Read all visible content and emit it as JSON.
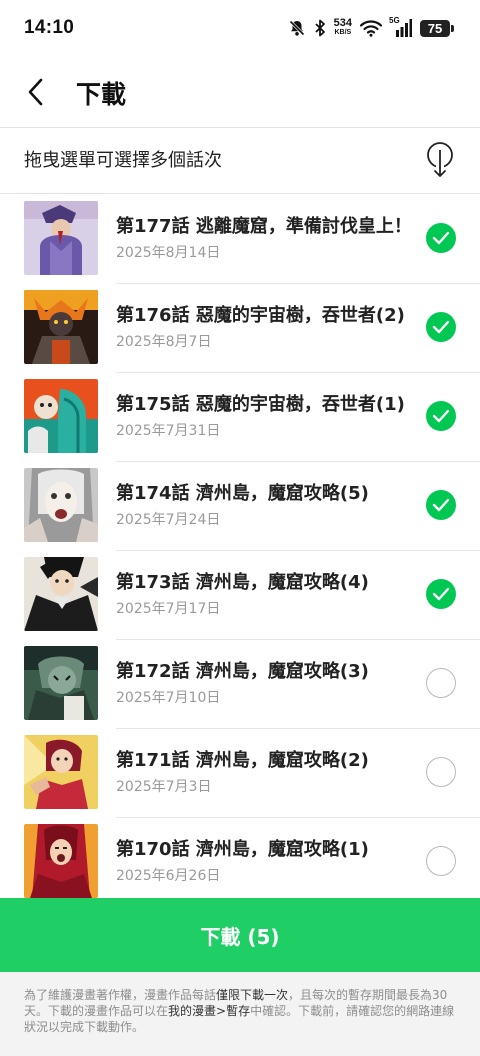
{
  "status_bar": {
    "time": "14:10",
    "net_speed_value": "534",
    "net_speed_unit": "KB/S",
    "network_label": "5G",
    "battery": "75",
    "icons": [
      "mute-icon",
      "bluetooth-icon",
      "wifi-icon",
      "signal-icon",
      "battery-icon"
    ]
  },
  "header": {
    "title": "下載",
    "back_icon": "chevron-left-icon"
  },
  "hint": {
    "text": "拖曳選單可選擇多個話次",
    "sort_icon": "sort-down-icon"
  },
  "episodes": [
    {
      "title": "第177話 逃離魔窟，準備討伐皇上！",
      "date": "2025年8月14日",
      "selected": true
    },
    {
      "title": "第176話 惡魔的宇宙樹，吞世者(2)",
      "date": "2025年8月7日",
      "selected": true
    },
    {
      "title": "第175話 惡魔的宇宙樹，吞世者(1)",
      "date": "2025年7月31日",
      "selected": true
    },
    {
      "title": "第174話 濟州島，魔窟攻略(5)",
      "date": "2025年7月24日",
      "selected": true
    },
    {
      "title": "第173話 濟州島，魔窟攻略(4)",
      "date": "2025年7月17日",
      "selected": true
    },
    {
      "title": "第172話 濟州島，魔窟攻略(3)",
      "date": "2025年7月10日",
      "selected": false
    },
    {
      "title": "第171話 濟州島，魔窟攻略(2)",
      "date": "2025年7月3日",
      "selected": false
    },
    {
      "title": "第170話 濟州島，魔窟攻略(1)",
      "date": "2025年6月26日",
      "selected": false
    }
  ],
  "download_button": {
    "label": "下載 (5)"
  },
  "notice": {
    "part1": "為了維護漫畫著作權，漫畫作品每話",
    "highlight1": "僅限下載一次",
    "part2": "，且每次的暫存期間最長為30天。下載的漫畫作品可以在",
    "highlight2": "我的漫畫>暫存",
    "part3": "中確認。下載前，請確認您的網路連線狀況以完成下載動作。"
  },
  "colors": {
    "accent_green": "#1fcf66",
    "check_green": "#00c853",
    "date_gray": "#9a9a9a"
  }
}
